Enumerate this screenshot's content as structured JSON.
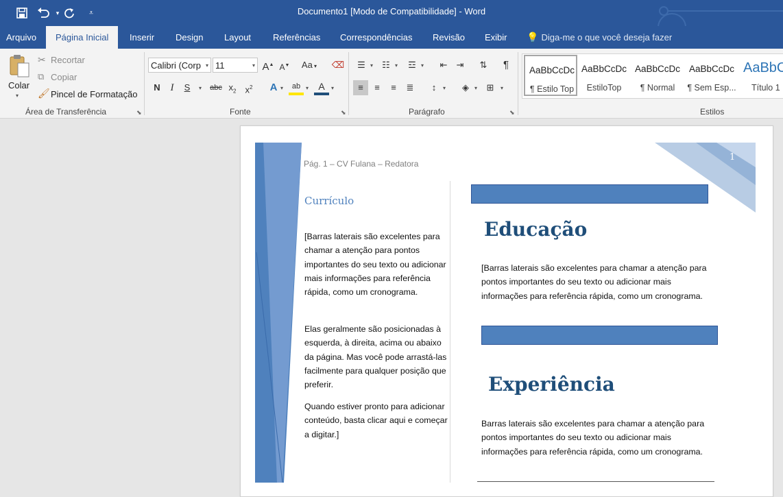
{
  "window": {
    "title": "Documento1 [Modo de Compatibilidade]  -  Word"
  },
  "qat": {
    "save_icon": "save-icon",
    "undo_icon": "undo-icon",
    "redo_icon": "redo-icon",
    "customize_icon": "customize-qat-icon"
  },
  "tabs": [
    "Arquivo",
    "Página Inicial",
    "Inserir",
    "Design",
    "Layout",
    "Referências",
    "Correspondências",
    "Revisão",
    "Exibir"
  ],
  "tellme": {
    "placeholder": "Diga-me o que você deseja fazer"
  },
  "clipboard": {
    "paste_label": "Colar",
    "cut_label": "Recortar",
    "copy_label": "Copiar",
    "format_painter_label": "Pincel de Formatação",
    "group_label": "Área de Transferência"
  },
  "font": {
    "family_value": "Calibri (Corp",
    "size_value": "11",
    "grow_label": "A",
    "shrink_label": "A",
    "case_label": "Aa",
    "bold_label": "N",
    "italic_label": "I",
    "underline_label": "S",
    "strike_label": "abc",
    "subscript_label": "x",
    "subscript_mark": "2",
    "superscript_label": "x",
    "superscript_mark": "2",
    "effects_label": "A",
    "highlight_label": "ab",
    "color_label": "A",
    "group_label": "Fonte"
  },
  "paragraph": {
    "group_label": "Parágrafo",
    "pilcrow": "¶"
  },
  "styles": {
    "group_label": "Estilos",
    "items": [
      {
        "preview": "AaBbCcDc",
        "name": "¶ Estilo Top"
      },
      {
        "preview": "AaBbCcDc",
        "name": "EstiloTop"
      },
      {
        "preview": "AaBbCcDc",
        "name": "¶ Normal"
      },
      {
        "preview": "AaBbCcDc",
        "name": "¶ Sem Esp..."
      },
      {
        "preview": "AaBbC",
        "name": "Título 1"
      }
    ]
  },
  "document": {
    "page_number": "1",
    "header_text": "Pág. 1 – CV Fulana – Redatora",
    "sidebar_title": "Currículo",
    "sidebar_para1": "[Barras laterais são excelentes para chamar a atenção para pontos importantes do seu texto ou adicionar mais informações para referência rápida, como um cronograma.",
    "sidebar_para2": "Elas geralmente são posicionadas à esquerda, à direita, acima ou abaixo da página. Mas você pode arrastá-las facilmente para qualquer posição que preferir.",
    "sidebar_para3": "Quando estiver pronto para adicionar conteúdo, basta clicar aqui e começar a digitar.]",
    "education_heading": "Educação",
    "education_body": "[Barras laterais são excelentes para chamar a atenção para pontos importantes do seu texto ou adicionar mais informações para referência rápida, como um cronograma.",
    "experience_heading": "Experiência",
    "experience_body": "Barras laterais são excelentes para chamar a atenção para pontos importantes do seu texto ou adicionar mais informações para referência rápida, como um cronograma."
  },
  "colors": {
    "accent": "#2b579a",
    "band_blue": "#4f81bd",
    "heading_blue": "#1f4e79"
  }
}
